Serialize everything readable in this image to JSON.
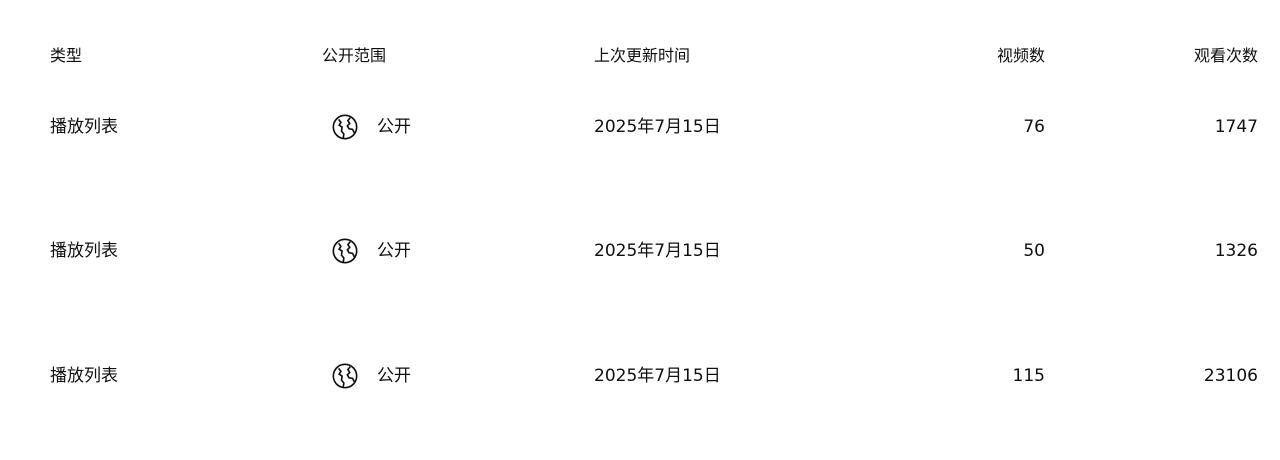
{
  "columns": {
    "type": "类型",
    "visibility": "公开范围",
    "last_updated": "上次更新时间",
    "video_count": "视频数",
    "view_count": "观看次数"
  },
  "rows": [
    {
      "type": "播放列表",
      "visibility_icon": "globe-icon",
      "visibility": "公开",
      "last_updated": "2025年7月15日",
      "video_count": "76",
      "view_count": "1747"
    },
    {
      "type": "播放列表",
      "visibility_icon": "globe-icon",
      "visibility": "公开",
      "last_updated": "2025年7月15日",
      "video_count": "50",
      "view_count": "1326"
    },
    {
      "type": "播放列表",
      "visibility_icon": "globe-icon",
      "visibility": "公开",
      "last_updated": "2025年7月15日",
      "video_count": "115",
      "view_count": "23106"
    }
  ]
}
